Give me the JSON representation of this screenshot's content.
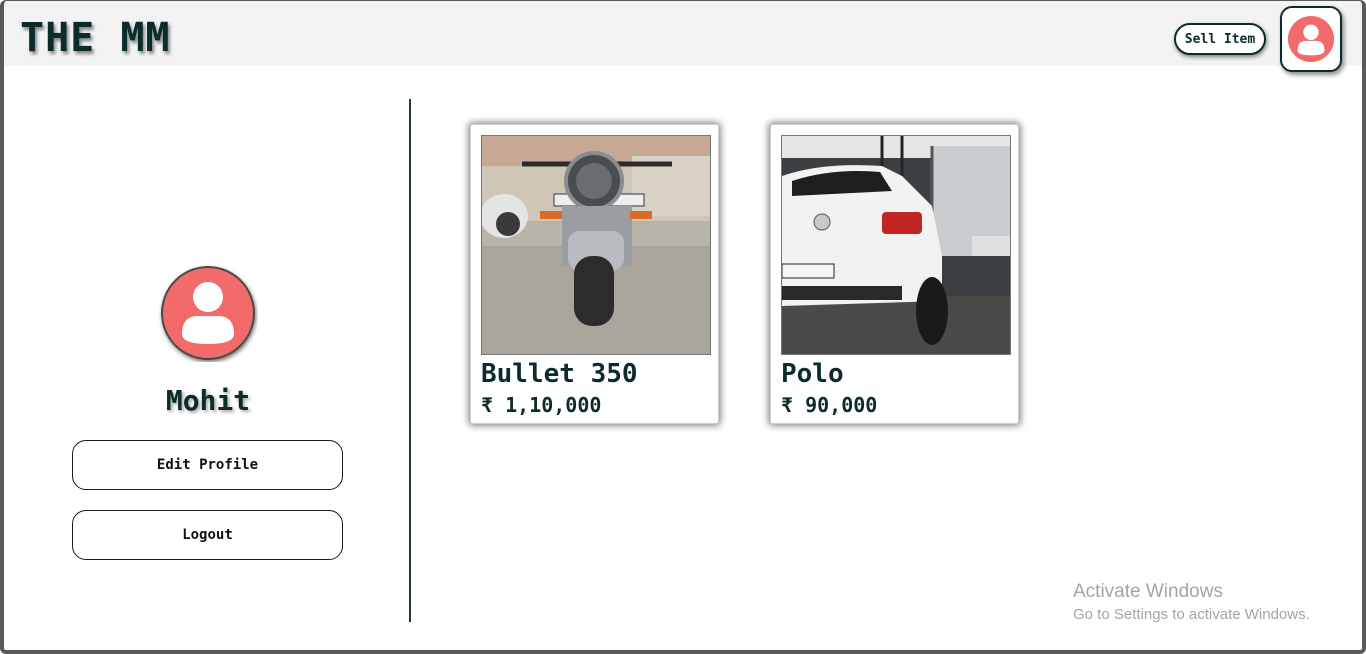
{
  "header": {
    "logo": "THE MM",
    "sell_item_label": "Sell Item",
    "avatar_icon": "user-avatar-icon"
  },
  "profile": {
    "name": "Mohit",
    "avatar_icon": "user-avatar-icon",
    "edit_profile_label": "Edit Profile",
    "logout_label": "Logout"
  },
  "items": [
    {
      "title": "Bullet 350",
      "price": "₹ 1,10,000",
      "image_subject": "motorcycle"
    },
    {
      "title": "Polo",
      "price": "₹ 90,000",
      "image_subject": "car"
    }
  ],
  "watermark": {
    "title": "Activate Windows",
    "subtitle": "Go to Settings to activate Windows."
  },
  "colors": {
    "accent_dark": "#0c2b2b",
    "avatar_red": "#f26b6b",
    "header_bg": "#f3f3f3"
  }
}
